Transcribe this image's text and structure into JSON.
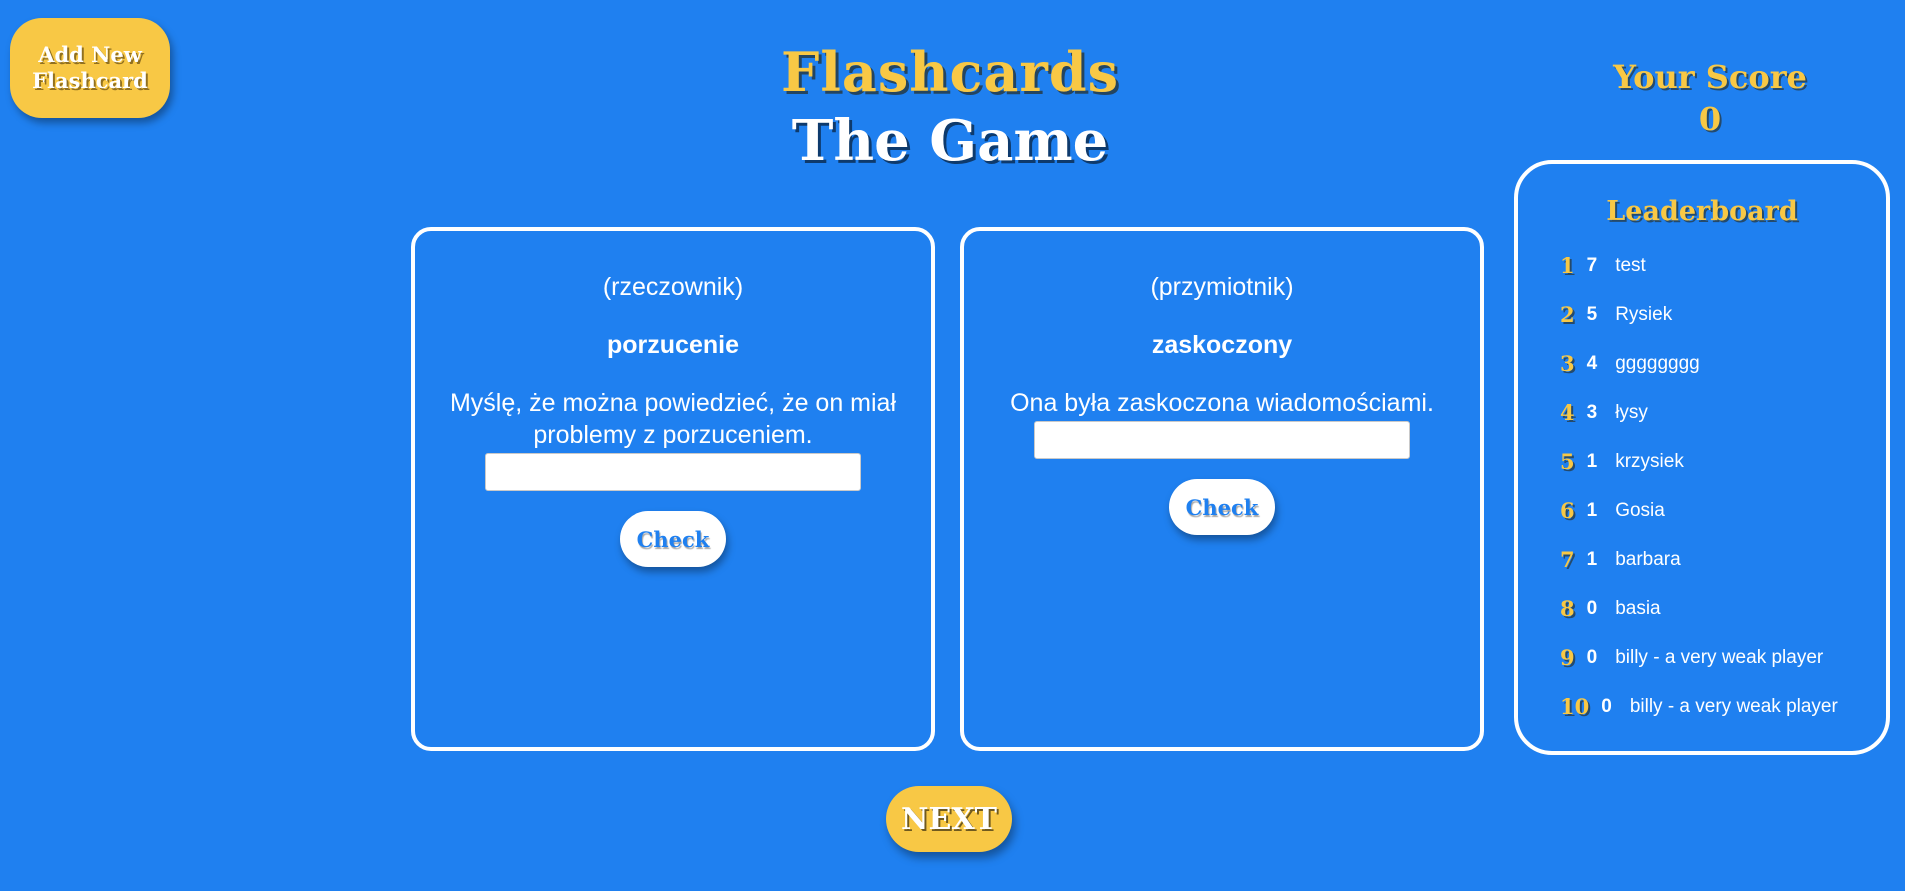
{
  "header": {
    "add_button_label": "Add New Flashcard",
    "title_line1": "Flashcards",
    "title_line2": "The Game"
  },
  "score": {
    "label": "Your Score",
    "value": "0"
  },
  "cards": [
    {
      "part_of_speech": "(rzeczownik)",
      "word": "porzucenie",
      "sentence": "Myślę, że można powiedzieć, że on miał problemy z porzuceniem.",
      "answer_value": "",
      "check_label": "Check"
    },
    {
      "part_of_speech": "(przymiotnik)",
      "word": "zaskoczony",
      "sentence": "Ona była zaskoczona wiadomościami.",
      "answer_value": "",
      "check_label": "Check"
    }
  ],
  "leaderboard": {
    "title": "Leaderboard",
    "rows": [
      {
        "rank": "1",
        "points": "7",
        "name": "test"
      },
      {
        "rank": "2",
        "points": "5",
        "name": "Rysiek"
      },
      {
        "rank": "3",
        "points": "4",
        "name": "gggggggg"
      },
      {
        "rank": "4",
        "points": "3",
        "name": "łysy"
      },
      {
        "rank": "5",
        "points": "1",
        "name": "krzysiek"
      },
      {
        "rank": "6",
        "points": "1",
        "name": "Gosia"
      },
      {
        "rank": "7",
        "points": "1",
        "name": "barbara"
      },
      {
        "rank": "8",
        "points": "0",
        "name": "basia"
      },
      {
        "rank": "9",
        "points": "0",
        "name": "billy - a very weak player"
      },
      {
        "rank": "10",
        "points": "0",
        "name": "billy - a very weak player"
      }
    ]
  },
  "footer": {
    "next_label": "NEXT"
  },
  "colors": {
    "background": "#1f80f0",
    "accent_yellow": "#f8c845",
    "white": "#ffffff"
  }
}
